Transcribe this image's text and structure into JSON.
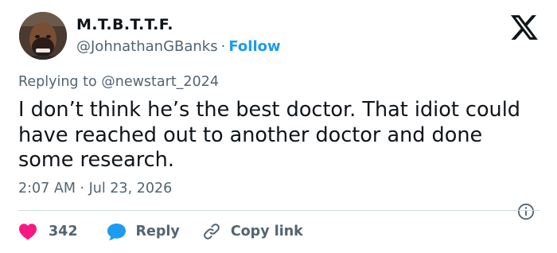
{
  "author": {
    "display_name": "M.T.B.T.T.F.",
    "handle": "@JohnathanGBanks",
    "separator": "·",
    "follow_label": "Follow"
  },
  "reply_context": {
    "prefix": "Replying to",
    "mention": "@newstart_2024"
  },
  "tweet": {
    "text": "I don’t think he’s the best doctor. That idiot could have reached out to another doctor and done some research.",
    "timestamp": "2:07 AM · Jul 23, 2026"
  },
  "actions": {
    "like_count": "342",
    "reply_label": "Reply",
    "copy_label": "Copy link"
  },
  "icons": {
    "logo": "x-logo-icon",
    "info": "info-icon",
    "like": "heart-icon",
    "reply": "speech-bubble-icon",
    "copy": "link-icon"
  },
  "colors": {
    "text_primary": "#0f1419",
    "text_secondary": "#536471",
    "accent": "#1d9bf0",
    "like": "#f91880",
    "divider": "#cfd9de"
  }
}
